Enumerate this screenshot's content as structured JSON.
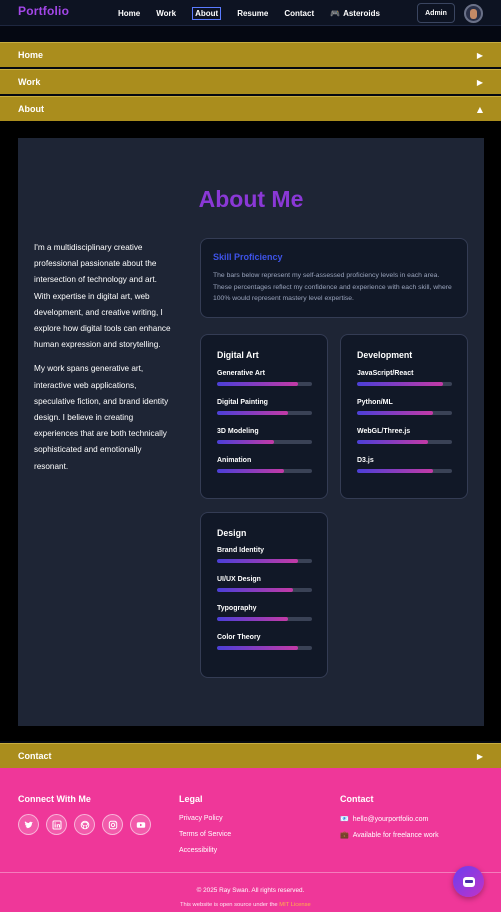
{
  "nav": {
    "brand": "Portfolio",
    "links": [
      "Home",
      "Work",
      "About",
      "Resume",
      "Contact",
      "Asteroids"
    ],
    "active": "About",
    "asteroids_icon": "game-controller-icon",
    "admin_label": "Admin"
  },
  "accordion": {
    "home": "Home",
    "work": "Work",
    "about": "About",
    "contact": "Contact",
    "collapsed_arrow": "▶",
    "expanded_arrow": "▲"
  },
  "about": {
    "title": "About Me",
    "bio": [
      "I'm a multidisciplinary creative professional passionate about the intersection of technology and art. With expertise in digital art, web development, and creative writing, I explore how digital tools can enhance human expression and storytelling.",
      "My work spans generative art, interactive web applications, speculative fiction, and brand identity design. I believe in creating experiences that are both technically sophisticated and emotionally resonant."
    ],
    "proficiency": {
      "title": "Skill Proficiency",
      "text": "The bars below represent my self-assessed proficiency levels in each area. These percentages reflect my confidence and experience with each skill, where 100% would represent mastery level expertise."
    },
    "skill_groups": [
      {
        "title": "Digital Art",
        "skills": [
          {
            "name": "Generative Art",
            "level": 0.85
          },
          {
            "name": "Digital Painting",
            "level": 0.75
          },
          {
            "name": "3D Modeling",
            "level": 0.6
          },
          {
            "name": "Animation",
            "level": 0.7
          }
        ]
      },
      {
        "title": "Development",
        "skills": [
          {
            "name": "JavaScript/React",
            "level": 0.9
          },
          {
            "name": "Python/ML",
            "level": 0.8
          },
          {
            "name": "WebGL/Three.js",
            "level": 0.75
          },
          {
            "name": "D3.js",
            "level": 0.8
          }
        ]
      },
      {
        "title": "Design",
        "skills": [
          {
            "name": "Brand Identity",
            "level": 0.85
          },
          {
            "name": "UI/UX Design",
            "level": 0.8
          },
          {
            "name": "Typography",
            "level": 0.75
          },
          {
            "name": "Color Theory",
            "level": 0.85
          }
        ]
      }
    ]
  },
  "footer": {
    "connect_title": "Connect With Me",
    "social_icons": [
      "twitter-icon",
      "linkedin-icon",
      "github-icon",
      "instagram-icon",
      "youtube-icon"
    ],
    "legal_title": "Legal",
    "legal_links": [
      "Privacy Policy",
      "Terms of Service",
      "Accessibility"
    ],
    "contact_title": "Contact",
    "email": "hello@yourportfolio.com",
    "availability": "Available for freelance work",
    "copyright": "© 2025 Ray Swan. All rights reserved.",
    "oss_text": "This website is open source under the",
    "oss_license": "MIT License"
  },
  "colors": {
    "accordion": "#aa8d1d",
    "footer": "#ef3799",
    "title": "#8a38d6",
    "accent": "#3e53e8"
  }
}
